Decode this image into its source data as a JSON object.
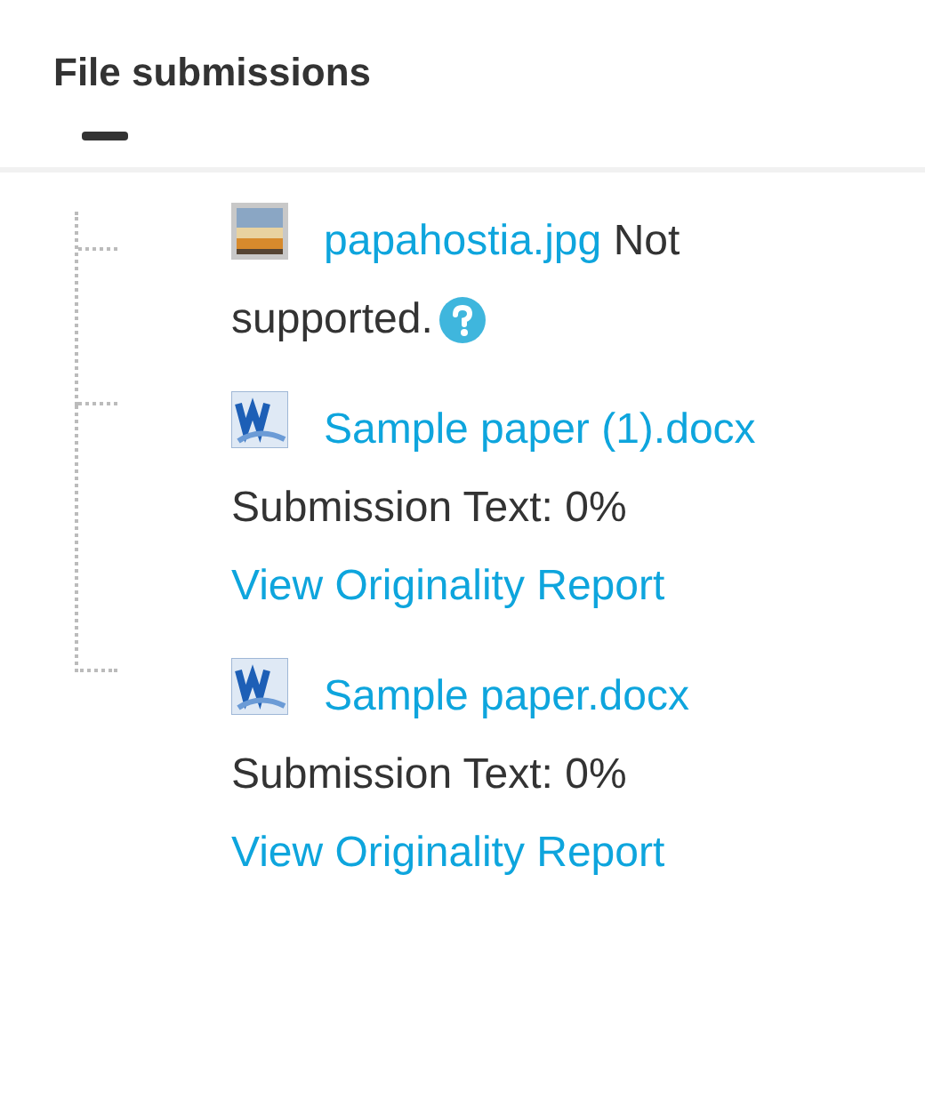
{
  "heading": "File submissions",
  "files": [
    {
      "kind": "image",
      "name": "papahostia.jpg",
      "status": "Not supported.",
      "help": true
    },
    {
      "kind": "document",
      "name": "Sample paper (1).docx",
      "score": "Submission Text: 0%",
      "report_link": "View Originality Report"
    },
    {
      "kind": "document",
      "name": "Sample paper.docx",
      "score": "Submission Text: 0%",
      "report_link": "View Originality Report"
    }
  ]
}
